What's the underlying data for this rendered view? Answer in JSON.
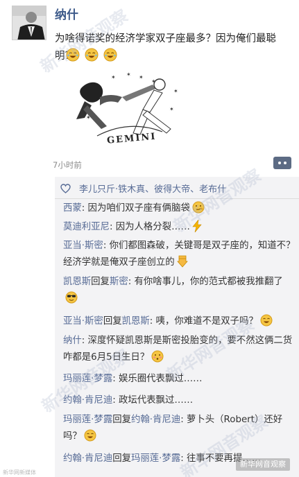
{
  "post": {
    "author": "纳什",
    "text": "为啥得诺奖的经济学家双子座最多？因为俺们最聪明？",
    "image_caption": "GEMINI"
  },
  "timestamp": "7小时前",
  "likes": "李儿只斤·铁木真、彼得大帝、老布什",
  "comments": [
    {
      "name": "西蒙",
      "text": ": 因为咱们双子座有俩脑袋",
      "emoji": "smirk"
    },
    {
      "name": "莫迪利亚尼",
      "text": ": 因为人格分裂……",
      "emoji": "lightning"
    },
    {
      "name": "亚当·斯密",
      "text": ": 你们都图森破，关键哥是双子座的，知道不？经济学就是俺双子座创立的",
      "emoji": "point-down"
    },
    {
      "name": "凯恩斯",
      "reply": "回复",
      "target": "斯密",
      "text": ": 有你啥事儿，你的范式都被我推翻了",
      "emoji": "sunglasses"
    },
    {
      "name": "亚当·斯密",
      "reply": "回复",
      "target": "凯恩斯",
      "text": ": 咦，你难道不是双子吗？",
      "emoji": "grin"
    },
    {
      "name": "纳什",
      "text": ": 深度怀疑凯恩斯是斯密投胎变的，要不然这俩二货咋都是6月5日生日？",
      "emoji": "blush"
    },
    {
      "name": "玛丽莲·梦露",
      "text": ": 娱乐圈代表飘过……",
      "emoji": ""
    },
    {
      "name": "约翰·肯尼迪",
      "text": ": 政坛代表飘过……",
      "emoji": ""
    },
    {
      "name": "玛丽莲·梦露",
      "reply": "回复",
      "target": "约翰·肯尼迪",
      "text": ": 萝卜头（Robert）还好吗？",
      "emoji": "grin"
    },
    {
      "name": "约翰·肯尼迪",
      "reply": "回复",
      "target": "玛丽莲·梦露",
      "text": ": 往事不要再提……",
      "emoji": ""
    }
  ],
  "watermarks": [
    "新华网音观察",
    "新华网音观察",
    "新华网音观察",
    "新华网音观察",
    "新华网音观察"
  ],
  "footer": {
    "left": "新华网新媒体",
    "right": "新华网音观察"
  },
  "colors": {
    "name_link": "#576b95",
    "comment_bg": "#f3f3f5",
    "text": "#222222"
  }
}
